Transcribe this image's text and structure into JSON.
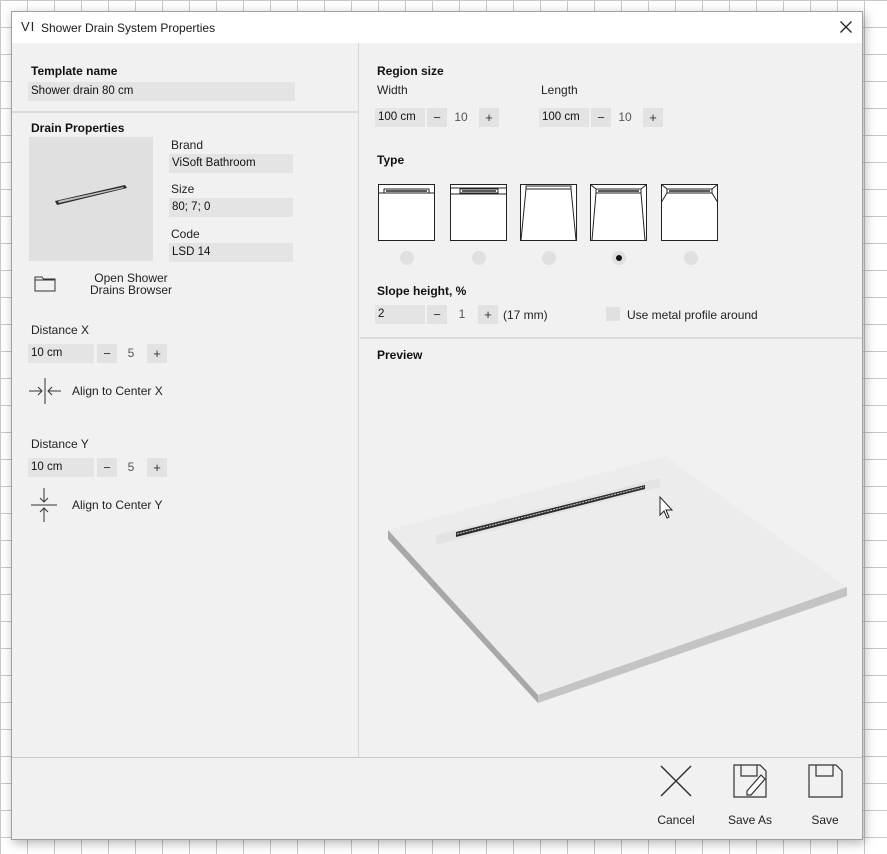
{
  "window": {
    "app_logo": "VI",
    "title": "Shower Drain System Properties"
  },
  "template": {
    "label": "Template name",
    "value": "Shower drain  80 cm"
  },
  "drain": {
    "section_title": "Drain Properties",
    "brand_label": "Brand",
    "brand_value": "ViSoft Bathroom",
    "size_label": "Size",
    "size_value": "80; 7; 0",
    "code_label": "Code",
    "code_value": "LSD 14",
    "browser_button": "Open Shower Drains Browser"
  },
  "distance_x": {
    "label": "Distance X",
    "value": "10 cm",
    "minus": "−",
    "step": "5",
    "plus": "+",
    "align_label": "Align to Center X"
  },
  "distance_y": {
    "label": "Distance Y",
    "value": "10 cm",
    "minus": "−",
    "step": "5",
    "plus": "+",
    "align_label": "Align to Center Y"
  },
  "region": {
    "title": "Region size",
    "width": {
      "label": "Width",
      "value": "100 cm",
      "minus": "−",
      "step": "10",
      "plus": "+"
    },
    "length": {
      "label": "Length",
      "value": "100 cm",
      "minus": "−",
      "step": "10",
      "plus": "+"
    }
  },
  "type": {
    "title": "Type",
    "options": 5,
    "selected_index": 3
  },
  "slope": {
    "title": "Slope height, %",
    "value": "2",
    "minus": "−",
    "step": "1",
    "plus": "+",
    "mm": "(17 mm)",
    "metal_profile_label": "Use metal profile around",
    "metal_profile_checked": false
  },
  "preview": {
    "title": "Preview"
  },
  "footer": {
    "cancel": "Cancel",
    "save_as": "Save As",
    "save": "Save"
  },
  "icons": {
    "close": "close-icon",
    "folder": "folder-icon",
    "align_x": "align-center-x-icon",
    "align_y": "align-center-y-icon",
    "cancel": "cancel-x-icon",
    "save_as": "save-as-icon",
    "save": "save-icon"
  }
}
